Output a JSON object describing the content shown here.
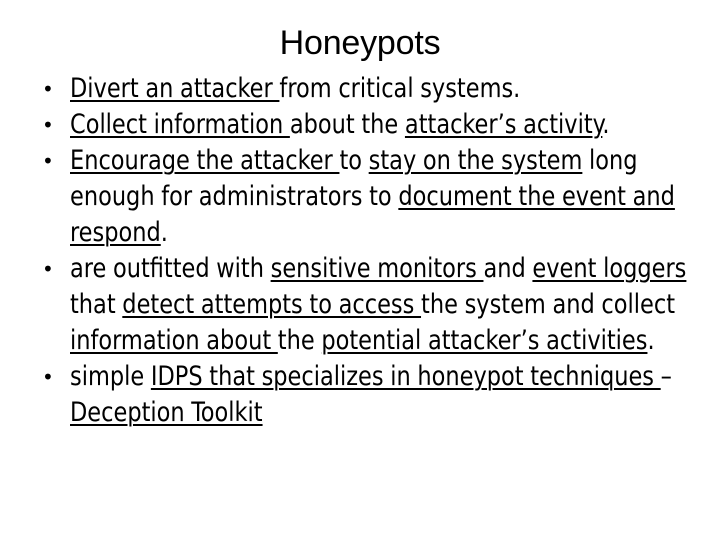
{
  "slide": {
    "title": "Honeypots",
    "background_color": "#ffffff",
    "text_color": "#000000",
    "bullet_marker": "•"
  },
  "bullets": [
    {
      "id": "bullet-1",
      "runs": [
        {
          "text": "Divert an attacker ",
          "underline": true
        },
        {
          "text": "from critical systems.",
          "underline": false
        }
      ]
    },
    {
      "id": "bullet-2",
      "runs": [
        {
          "text": "Collect information ",
          "underline": true
        },
        {
          "text": "about the ",
          "underline": false
        },
        {
          "text": "attacker’s activity",
          "underline": true
        },
        {
          "text": ".",
          "underline": false
        }
      ]
    },
    {
      "id": "bullet-3",
      "runs": [
        {
          "text": "Encourage the attacker ",
          "underline": true
        },
        {
          "text": "to ",
          "underline": false
        },
        {
          "text": "stay on the system",
          "underline": true
        },
        {
          "text": " long enough for administrators to ",
          "underline": false
        },
        {
          "text": "document the event and respond",
          "underline": true
        },
        {
          "text": ".",
          "underline": false
        }
      ]
    },
    {
      "id": "bullet-4",
      "runs": [
        {
          "text": "are outfitted with ",
          "underline": false
        },
        {
          "text": "sensitive monitors ",
          "underline": true
        },
        {
          "text": "and ",
          "underline": false
        },
        {
          "text": "event loggers ",
          "underline": true
        },
        {
          "text": "that ",
          "underline": false
        },
        {
          "text": "detect attempts to access ",
          "underline": true
        },
        {
          "text": "the system and collect ",
          "underline": false
        },
        {
          "text": "information about ",
          "underline": true
        },
        {
          "text": "the ",
          "underline": false
        },
        {
          "text": "potential attacker’s activities",
          "underline": true
        },
        {
          "text": ".",
          "underline": false
        }
      ]
    },
    {
      "id": "bullet-5",
      "runs": [
        {
          "text": "simple ",
          "underline": false
        },
        {
          "text": "IDPS that specializes in honeypot techniques ",
          "underline": true
        },
        {
          "text": "– ",
          "underline": false
        },
        {
          "text": "Deception Toolkit",
          "underline": true
        }
      ]
    }
  ]
}
